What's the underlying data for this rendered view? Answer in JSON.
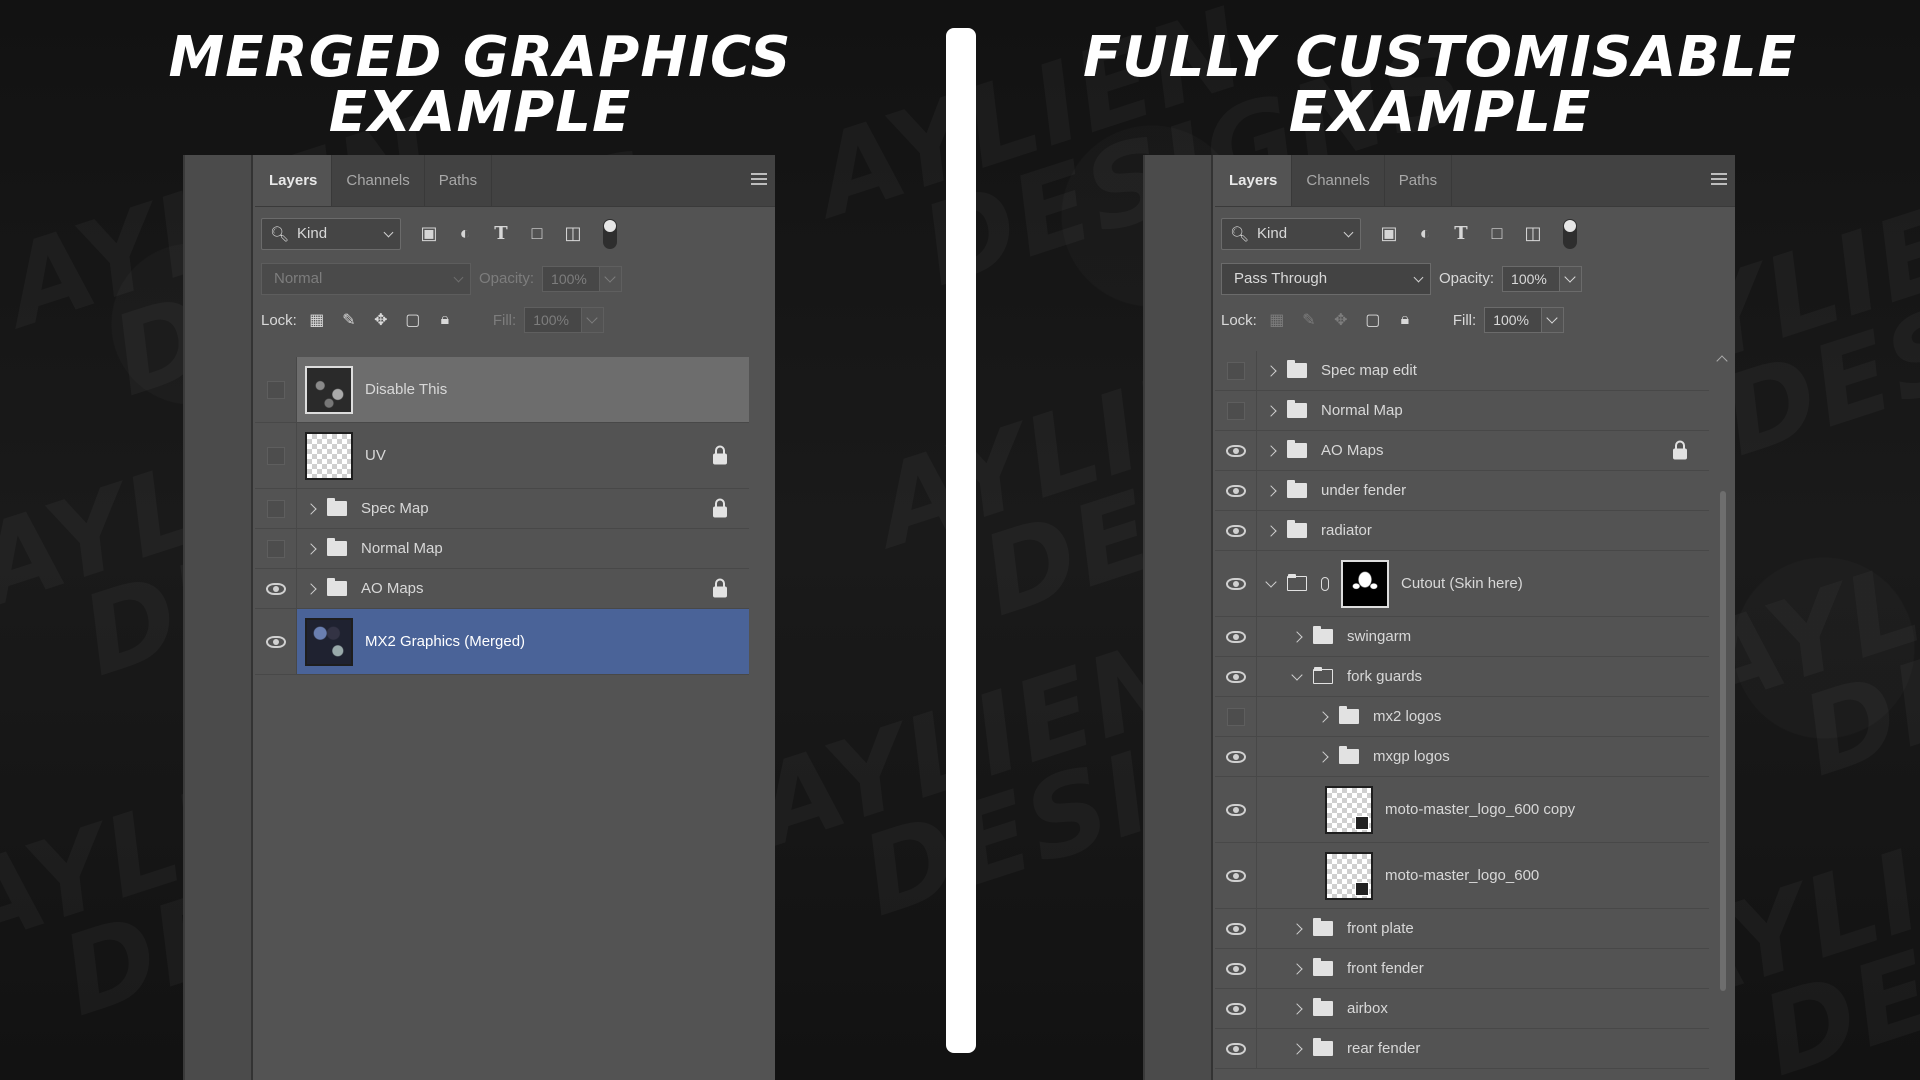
{
  "left": {
    "title_line1": "MERGED GRAPHICS",
    "title_line2": "EXAMPLE",
    "tabs": [
      "Layers",
      "Channels",
      "Paths"
    ],
    "filter_kind": "Kind",
    "blend_mode": "Normal",
    "opacity_label": "Opacity:",
    "opacity_value": "100%",
    "lock_label": "Lock:",
    "fill_label": "Fill:",
    "fill_value": "100%",
    "layers": [
      {
        "name": "Disable This",
        "visible": false,
        "type": "image",
        "locked": false
      },
      {
        "name": "UV",
        "visible": false,
        "type": "image",
        "locked": true
      },
      {
        "name": "Spec Map",
        "visible": false,
        "type": "folder",
        "locked": true
      },
      {
        "name": "Normal Map",
        "visible": false,
        "type": "folder",
        "locked": false
      },
      {
        "name": "AO Maps",
        "visible": true,
        "type": "folder",
        "locked": true
      },
      {
        "name": "MX2 Graphics (Merged)",
        "visible": true,
        "type": "image",
        "locked": false
      }
    ]
  },
  "right": {
    "title_line1": "FULLY CUSTOMISABLE",
    "title_line2": "EXAMPLE",
    "tabs": [
      "Layers",
      "Channels",
      "Paths"
    ],
    "filter_kind": "Kind",
    "blend_mode": "Pass Through",
    "opacity_label": "Opacity:",
    "opacity_value": "100%",
    "lock_label": "Lock:",
    "fill_label": "Fill:",
    "fill_value": "100%",
    "layers": [
      {
        "name": "Spec map edit",
        "visible": false,
        "type": "folder",
        "indent": 0
      },
      {
        "name": "Normal Map",
        "visible": false,
        "type": "folder",
        "indent": 0
      },
      {
        "name": "AO Maps",
        "visible": true,
        "type": "folder",
        "indent": 0,
        "locked": true
      },
      {
        "name": "under fender",
        "visible": true,
        "type": "folder",
        "indent": 0
      },
      {
        "name": "radiator",
        "visible": true,
        "type": "folder",
        "indent": 0
      },
      {
        "name": "Cutout (Skin here)",
        "visible": true,
        "type": "folder-open-mask",
        "indent": 0
      },
      {
        "name": "swingarm",
        "visible": true,
        "type": "folder",
        "indent": 1
      },
      {
        "name": "fork guards",
        "visible": true,
        "type": "folder-open",
        "indent": 1
      },
      {
        "name": "mx2 logos",
        "visible": false,
        "type": "folder",
        "indent": 2
      },
      {
        "name": "mxgp logos",
        "visible": true,
        "type": "folder",
        "indent": 2
      },
      {
        "name": "moto-master_logo_600 copy",
        "visible": true,
        "type": "smart",
        "indent": 2
      },
      {
        "name": "moto-master_logo_600",
        "visible": true,
        "type": "smart",
        "indent": 2
      },
      {
        "name": "front plate",
        "visible": true,
        "type": "folder",
        "indent": 1
      },
      {
        "name": "front fender",
        "visible": true,
        "type": "folder",
        "indent": 1
      },
      {
        "name": "airbox",
        "visible": true,
        "type": "folder",
        "indent": 1
      },
      {
        "name": "rear fender",
        "visible": true,
        "type": "folder",
        "indent": 1
      }
    ]
  },
  "colors": {
    "background": "#0d0d0d",
    "panel": "#535353",
    "selected": "#4a6398",
    "title": "#ffffff"
  },
  "watermark": [
    "AYLIEN",
    "DESIGNS"
  ]
}
